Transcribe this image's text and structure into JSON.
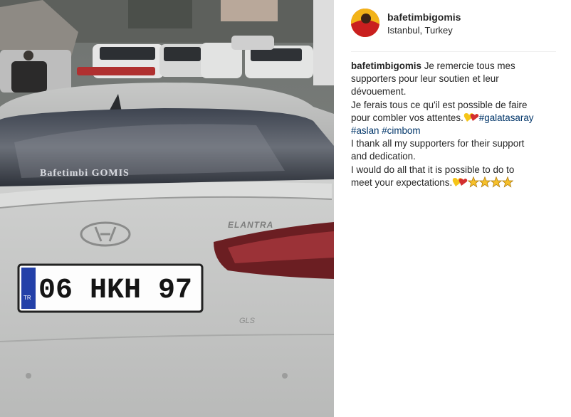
{
  "post": {
    "author": "bafetimbigomis",
    "location": "Istanbul, Turkey"
  },
  "photo": {
    "windshield_text": "Bafetimbi GOMIS",
    "model_badge": "ELANTRA",
    "trim_badge": "GLS",
    "plate_country": "TR",
    "plate_number": "06 HKH 97"
  },
  "caption": {
    "author": "bafetimbigomis",
    "line1": "Je remercie tous mes",
    "line2": "supporters pour leur soutien et leur",
    "line3": "dévouement.",
    "line4": "Je ferais tous ce qu'il est possible de faire",
    "line5_text": "pour combler vos attentes.",
    "hashtag1": "#galatasaray",
    "hashtag2": "#aslan",
    "hashtag3": "#cimbom",
    "line7": "I thank all my supporters for their support",
    "line8": "and dedication.",
    "line9": "I would do all that it is possible to do to",
    "line10_text": "meet your expectations."
  },
  "icons": {
    "heart_emoji": "yellow-red-heart-icon",
    "star_emoji": "star-icon"
  },
  "colors": {
    "hashtag": "#003569",
    "text": "#262626",
    "heart_left": "#f5c518",
    "heart_right": "#d32f2f",
    "star": "#f6c02b"
  }
}
